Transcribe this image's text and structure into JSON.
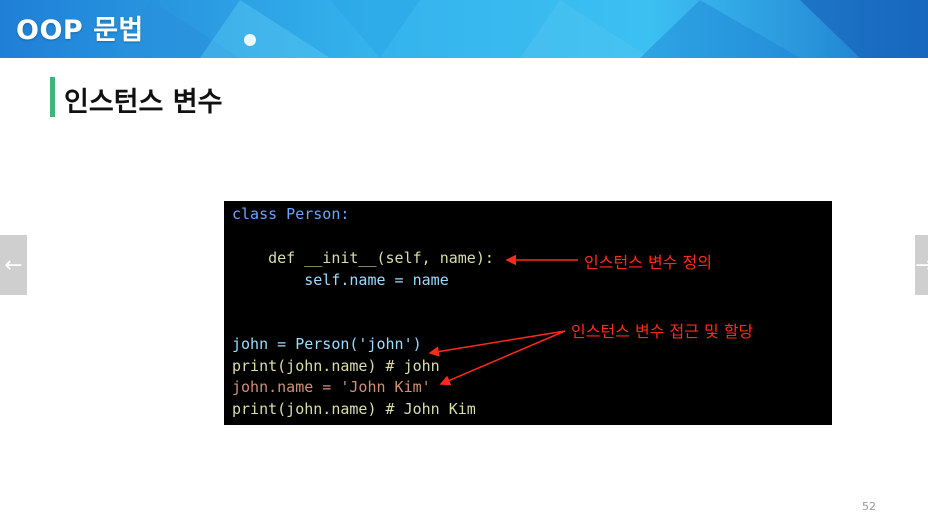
{
  "header": {
    "title": "OOP 문법"
  },
  "section": {
    "title": "인스턴스 변수"
  },
  "nav": {
    "prev_icon": "arrow-left-icon",
    "next_icon": "arrow-right-icon"
  },
  "code": {
    "lines": [
      "class Person:",
      "",
      "    def __init__(self, name):",
      "        self.name = name",
      "",
      "",
      "john = Person('john')",
      "print(john.name) # john",
      "john.name = 'John Kim'",
      "print(john.name) # John Kim"
    ]
  },
  "annotations": {
    "definition": "인스턴스 변수 정의",
    "access": "인스턴스 변수 접근 및 할당"
  },
  "footer": {
    "page_number": "52"
  },
  "colors": {
    "annotation": "#ff2a1a",
    "accent_bar": "#3fb57a",
    "banner": "#34b3ec"
  }
}
